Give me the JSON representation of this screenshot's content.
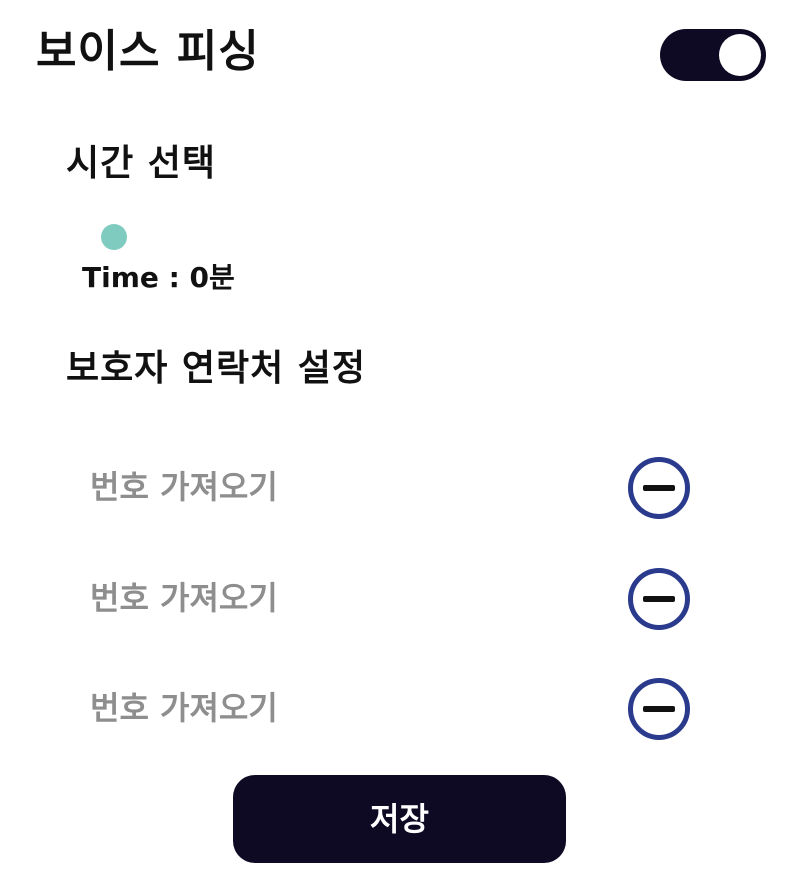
{
  "header": {
    "title": "보이스 피싱",
    "toggle_on": true
  },
  "time_section": {
    "title": "시간 선택",
    "time_label": "Time : 0분",
    "slider_value": 0,
    "slider_color": "#7fcbbf"
  },
  "contact_section": {
    "title": "보호자 연락처 설정",
    "rows": [
      {
        "label": "번호 가져오기",
        "icon": "minus-circle-icon"
      },
      {
        "label": "번호 가져오기",
        "icon": "minus-circle-icon"
      },
      {
        "label": "번호 가져오기",
        "icon": "minus-circle-icon"
      }
    ]
  },
  "footer": {
    "save_label": "저장"
  },
  "colors": {
    "dark": "#0f0a24",
    "accent_icon": "#2a3a8c",
    "muted_text": "#8e8e8e"
  }
}
